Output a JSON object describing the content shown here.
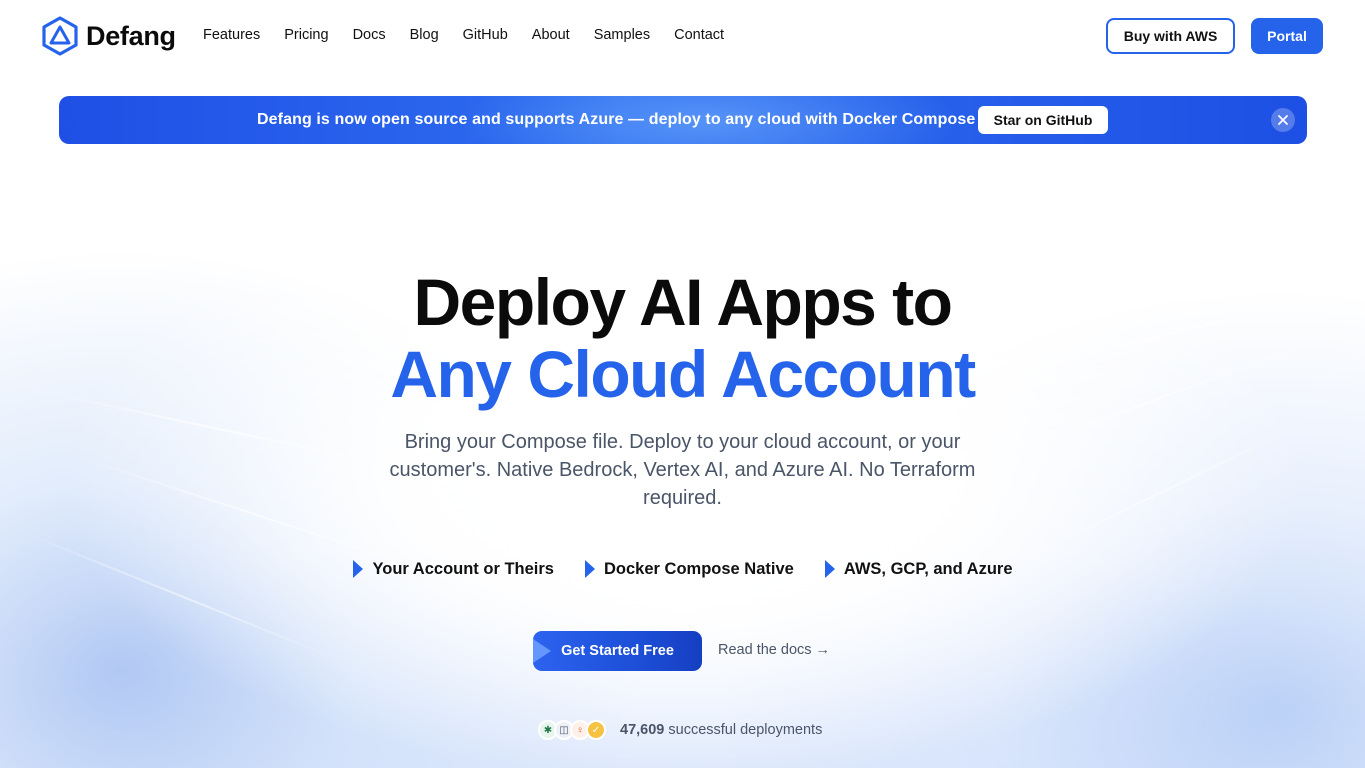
{
  "brand": {
    "name": "Defang",
    "accent": "#2563eb"
  },
  "nav": {
    "items": [
      "Features",
      "Pricing",
      "Docs",
      "Blog",
      "GitHub",
      "About",
      "Samples",
      "Contact"
    ]
  },
  "header": {
    "buy_aws": "Buy with AWS",
    "portal": "Portal"
  },
  "banner": {
    "text": "Defang is now open source and supports Azure — deploy to any cloud with Docker Compose",
    "button": "Star on GitHub",
    "close_icon": "close-icon"
  },
  "hero": {
    "title_line1": "Deploy AI Apps to",
    "title_line2": "Any Cloud Account",
    "subtitle": "Bring your Compose file. Deploy to your cloud account, or your customer's. Native Bedrock, Vertex AI, and Azure AI. No Terraform required.",
    "features": [
      {
        "label": "Your Account or Theirs",
        "icon": "triangle-icon"
      },
      {
        "label": "Docker Compose Native",
        "icon": "triangle-icon"
      },
      {
        "label": "AWS, GCP, and Azure",
        "icon": "triangle-icon"
      }
    ],
    "cta_primary": "Get Started Free",
    "cta_secondary": "Read the docs →",
    "deployments_count": "47,609",
    "deployments_label": "successful deployments"
  },
  "colors": {
    "title_blue": "#2563eb",
    "banner_bg": "#1f4fe6",
    "body_text": "#4a5568"
  }
}
